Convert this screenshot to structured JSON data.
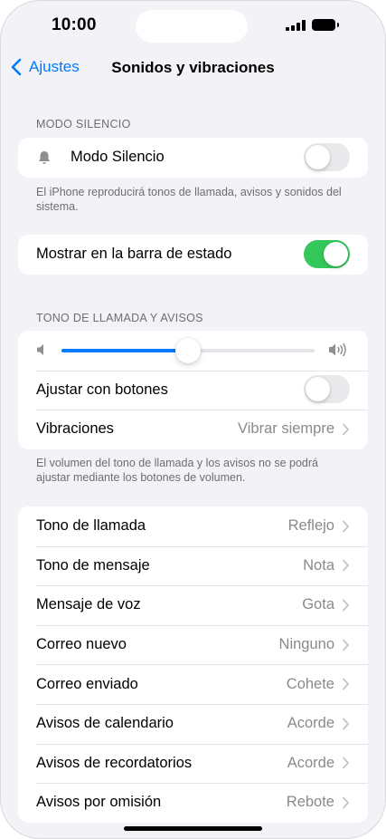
{
  "status_bar": {
    "time": "10:00"
  },
  "nav": {
    "back_label": "Ajustes",
    "title": "Sonidos y vibraciones"
  },
  "silent_section": {
    "header": "MODO SILENCIO",
    "row_label": "Modo Silencio",
    "toggle_on": false,
    "footer": "El iPhone reproducirá tonos de llamada, avisos y sonidos del sistema."
  },
  "status_bar_section": {
    "row_label": "Mostrar en la barra de estado",
    "toggle_on": true
  },
  "ringer_section": {
    "header": "TONO DE LLAMADA Y AVISOS",
    "volume_fraction": 0.5,
    "adjust_label": "Ajustar con botones",
    "adjust_on": false,
    "vibrations_label": "Vibraciones",
    "vibrations_value": "Vibrar siempre",
    "footer": "El volumen del tono de llamada y los avisos no se podrá ajustar mediante los botones de volumen."
  },
  "sounds_section": {
    "rows": [
      {
        "label": "Tono de llamada",
        "value": "Reflejo"
      },
      {
        "label": "Tono de mensaje",
        "value": "Nota"
      },
      {
        "label": "Mensaje de voz",
        "value": "Gota"
      },
      {
        "label": "Correo nuevo",
        "value": "Ninguno"
      },
      {
        "label": "Correo enviado",
        "value": "Cohete"
      },
      {
        "label": "Avisos de calendario",
        "value": "Acorde"
      },
      {
        "label": "Avisos de recordatorios",
        "value": "Acorde"
      },
      {
        "label": "Avisos por omisión",
        "value": "Rebote"
      }
    ]
  },
  "colors": {
    "accent": "#007aff",
    "toggle_on": "#34c759",
    "toggle_off": "#e9e9eb"
  }
}
